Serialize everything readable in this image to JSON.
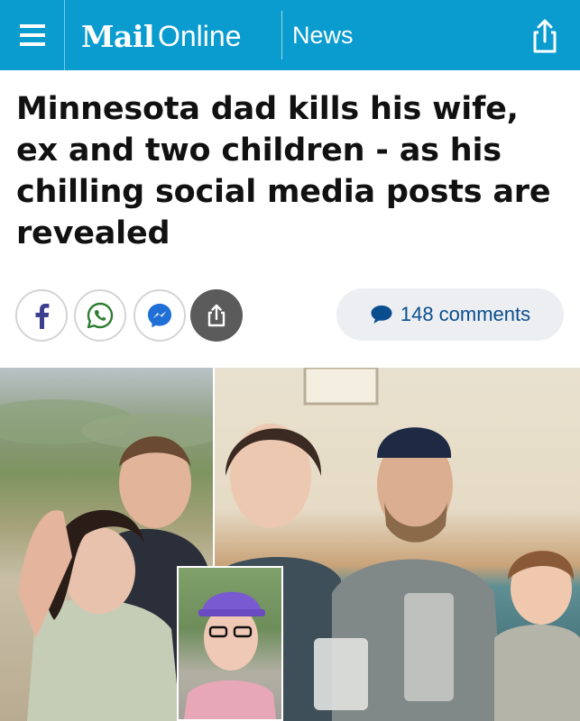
{
  "header": {
    "brand_mail": "Mail",
    "brand_online": "Online",
    "section": "News",
    "brand_color": "#0b9ccf"
  },
  "article": {
    "headline": "Minnesota dad kills his wife, ex and two children - as his chilling social media posts are revealed"
  },
  "share": {
    "buttons": [
      {
        "icon": "facebook-icon"
      },
      {
        "icon": "whatsapp-icon"
      },
      {
        "icon": "messenger-icon"
      },
      {
        "icon": "share-icon"
      }
    ]
  },
  "comments": {
    "label": "148 comments",
    "icon": "speech-bubble-icon",
    "color": "#0a4e8f"
  },
  "icons": {
    "menu": "hamburger-menu-icon",
    "share_top": "share-icon"
  }
}
